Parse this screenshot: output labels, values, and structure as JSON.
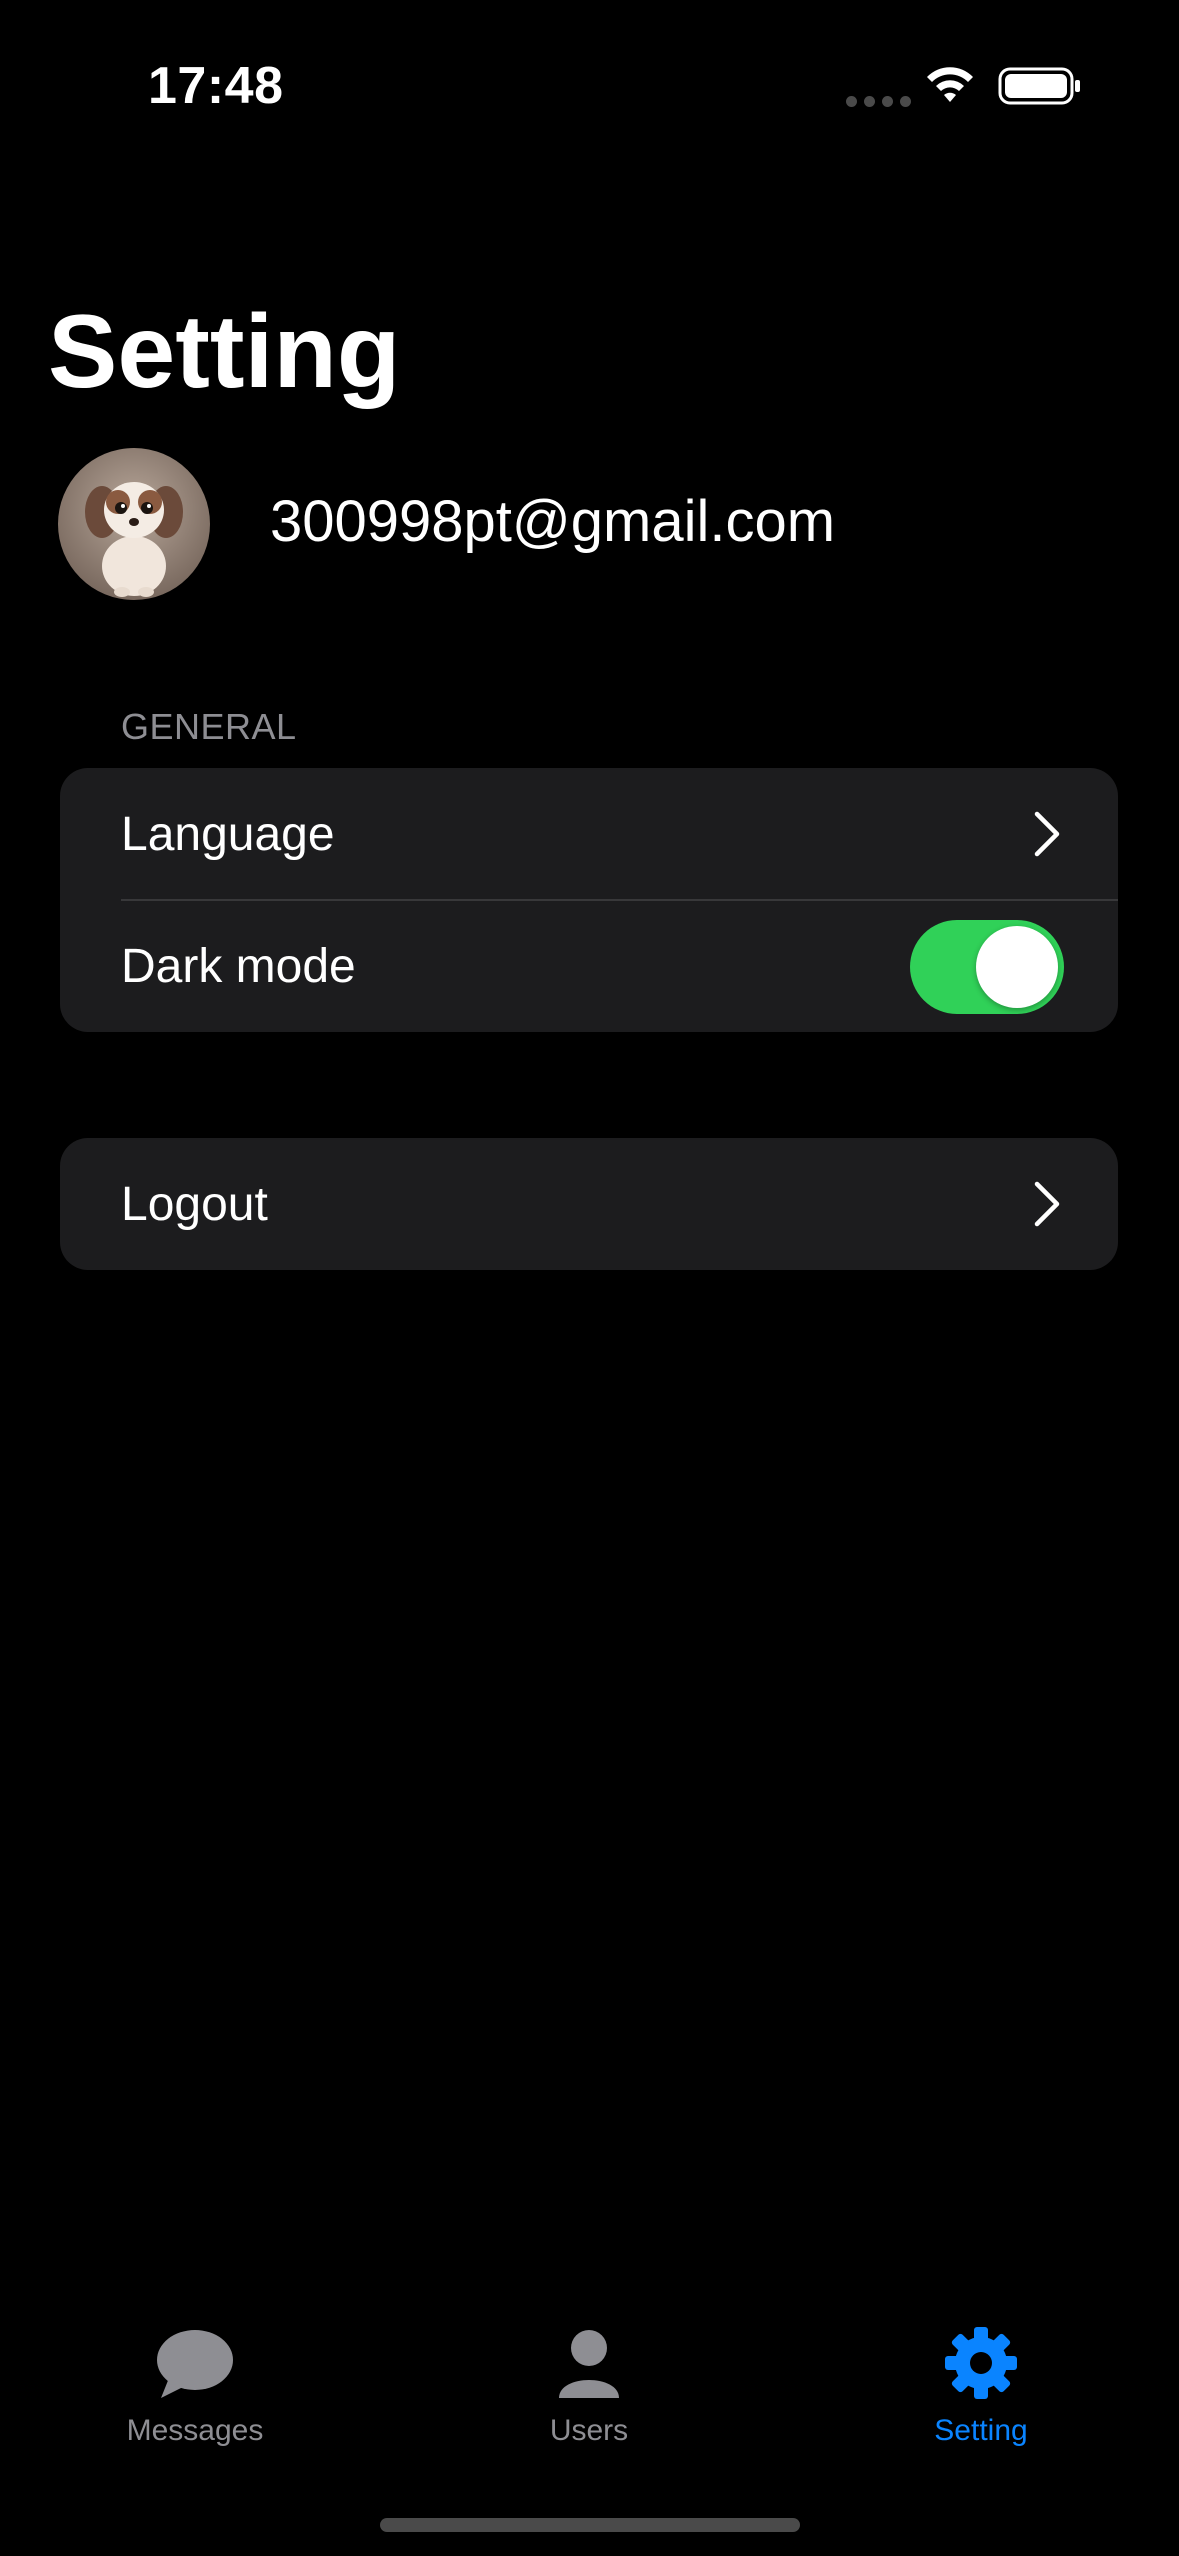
{
  "status_bar": {
    "time": "17:48"
  },
  "page": {
    "title": "Setting"
  },
  "profile": {
    "email": "300998pt@gmail.com",
    "avatar_icon": "puppy-avatar-icon"
  },
  "general": {
    "header": "GENERAL",
    "language_label": "Language",
    "dark_mode_label": "Dark mode",
    "dark_mode_enabled": true
  },
  "account": {
    "logout_label": "Logout"
  },
  "tab_bar": {
    "tabs": [
      {
        "label": "Messages",
        "icon": "chat-bubble-icon",
        "active": false
      },
      {
        "label": "Users",
        "icon": "person-icon",
        "active": false
      },
      {
        "label": "Setting",
        "icon": "gear-icon",
        "active": true
      }
    ]
  },
  "colors": {
    "background": "#000000",
    "group_background": "#1c1c1e",
    "toggle_on": "#30d158",
    "accent": "#0a84ff",
    "secondary_text": "#8e8e93"
  }
}
